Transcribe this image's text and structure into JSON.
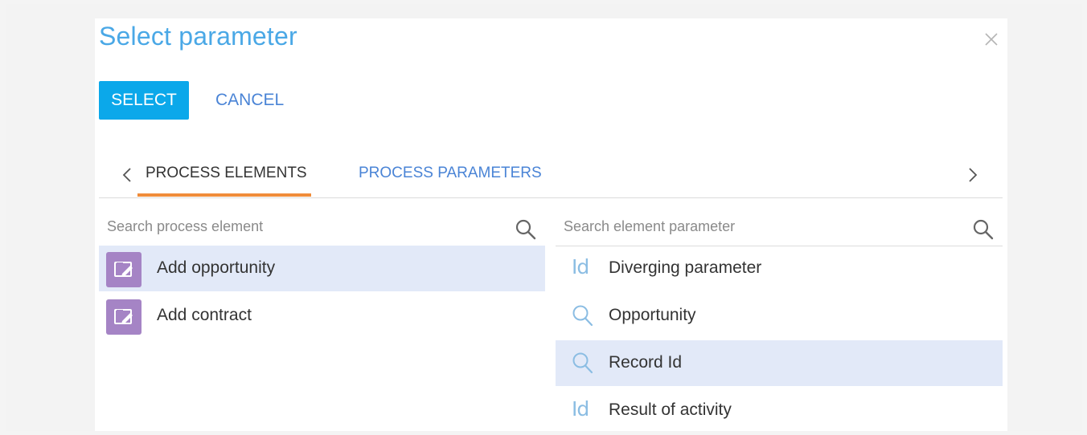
{
  "dialog": {
    "title": "Select parameter",
    "select_label": "SELECT",
    "cancel_label": "CANCEL"
  },
  "tabs": [
    {
      "label": "PROCESS ELEMENTS",
      "active": true
    },
    {
      "label": "PROCESS PARAMETERS",
      "active": false
    }
  ],
  "left_panel": {
    "search_placeholder": "Search process element",
    "items": [
      {
        "label": "Add opportunity",
        "icon": "edit-page-icon",
        "selected": true
      },
      {
        "label": "Add contract",
        "icon": "edit-page-icon",
        "selected": false
      }
    ]
  },
  "right_panel": {
    "search_placeholder": "Search element parameter",
    "items": [
      {
        "label": "Diverging parameter",
        "icon": "id-icon",
        "icon_text": "Id",
        "selected": false
      },
      {
        "label": "Opportunity",
        "icon": "lookup-icon",
        "selected": false
      },
      {
        "label": "Record Id",
        "icon": "lookup-icon",
        "selected": true
      },
      {
        "label": "Result of activity",
        "icon": "id-icon",
        "icon_text": "Id",
        "selected": false
      }
    ]
  },
  "colors": {
    "title": "#4aa8e6",
    "select_button": "#0ba8ea",
    "link": "#4a84d6",
    "tab_underline": "#f08c3a",
    "selected_row": "#e2e9f8",
    "element_icon": "#a584c5",
    "param_icon": "#8bbde3"
  }
}
